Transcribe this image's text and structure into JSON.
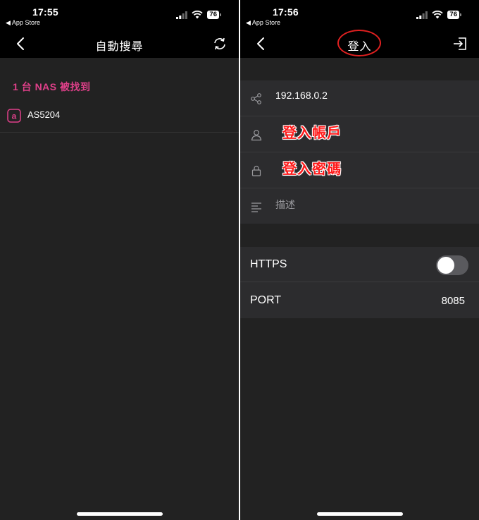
{
  "left": {
    "status": {
      "time": "17:55",
      "back_app": "◀ App Store",
      "battery": "76"
    },
    "nav": {
      "title": "自動搜尋"
    },
    "found_text": "1 台 NAS 被找到",
    "device": {
      "name": "AS5204"
    }
  },
  "right": {
    "status": {
      "time": "17:56",
      "back_app": "◀ App Store",
      "battery": "76"
    },
    "nav": {
      "title": "登入"
    },
    "form": {
      "ip": "192.168.0.2",
      "account_annotation": "登入帳戶",
      "password_annotation": "登入密碼",
      "description_placeholder": "描述"
    },
    "options": {
      "https_label": "HTTPS",
      "https_enabled": false,
      "port_label": "PORT",
      "port_value": "8085"
    }
  },
  "colors": {
    "accent_pink": "#e0408a",
    "annotation_red": "#ff1a1a",
    "background": "#222222",
    "bar": "#000000"
  },
  "icons": {
    "back": "chevron-left-icon",
    "refresh": "refresh-icon",
    "login": "login-icon",
    "share": "share-icon",
    "user": "user-icon",
    "lock": "lock-icon",
    "description": "lines-icon",
    "device": "asustor-icon"
  }
}
